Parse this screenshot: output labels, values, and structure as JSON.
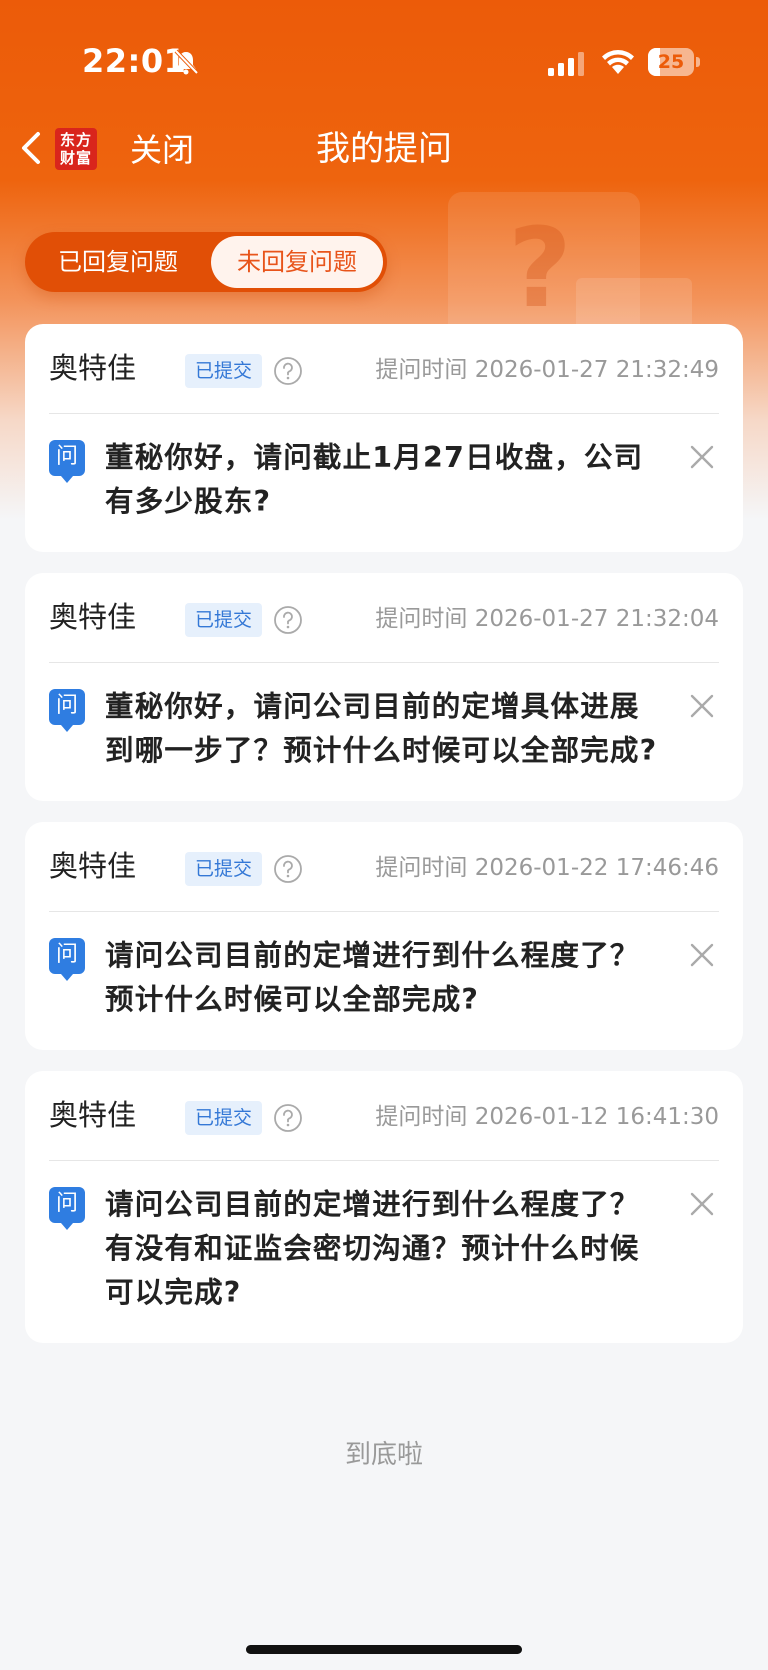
{
  "status_bar": {
    "time": "22:01",
    "battery": "25",
    "battery_level": 0.25
  },
  "nav": {
    "logo_line1": "东方",
    "logo_line2": "财富",
    "close_label": "关闭",
    "title": "我的提问"
  },
  "tabs": [
    {
      "label": "已回复问题"
    },
    {
      "label": "未回复问题"
    }
  ],
  "questions": [
    {
      "company": "奥特佳",
      "status": "已提交",
      "time": "提问时间 2026-01-27 21:32:49",
      "icon_label": "问",
      "text": "董秘你好，请问截止1月27日收盘，公司有多少股东?"
    },
    {
      "company": "奥特佳",
      "status": "已提交",
      "time": "提问时间 2026-01-27 21:32:04",
      "icon_label": "问",
      "text": "董秘你好，请问公司目前的定增具体进展到哪一步了？预计什么时候可以全部完成?"
    },
    {
      "company": "奥特佳",
      "status": "已提交",
      "time": "提问时间 2026-01-22 17:46:46",
      "icon_label": "问",
      "text": "请问公司目前的定增进行到什么程度了？预计什么时候可以全部完成?"
    },
    {
      "company": "奥特佳",
      "status": "已提交",
      "time": "提问时间 2026-01-12 16:41:30",
      "icon_label": "问",
      "text": "请问公司目前的定增进行到什么程度了？有没有和证监会密切沟通？预计什么时候可以完成?"
    }
  ],
  "footer": {
    "end_text": "到底啦"
  },
  "colors": {
    "brand": "#ec5b09",
    "badge": "#3478d6",
    "question_icon": "#2f7de1"
  }
}
